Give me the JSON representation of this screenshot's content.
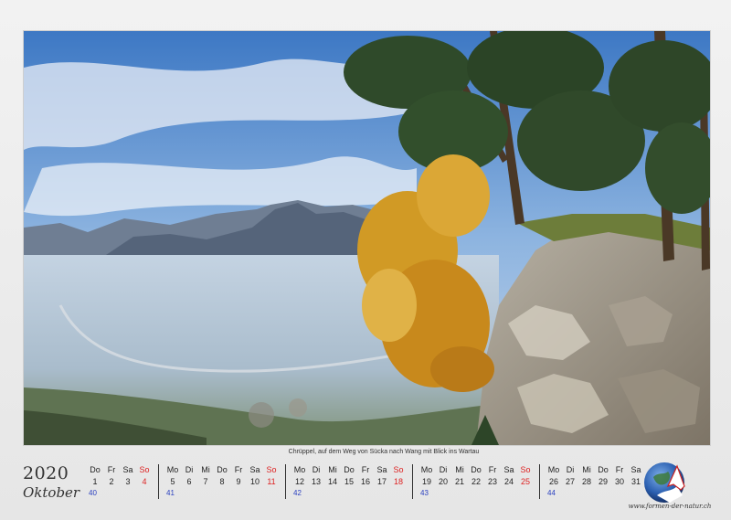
{
  "caption": "Chrüppel, auf dem Weg von Sücka nach Wang mit Blick ins Wartau",
  "year": "2020",
  "month": "Oktober",
  "accent_colors": {
    "sunday": "#dd2222",
    "week_number": "#2a3fbf"
  },
  "weeks": [
    {
      "kw": "40",
      "days": [
        {
          "dn": "Do",
          "d": "1"
        },
        {
          "dn": "Fr",
          "d": "2"
        },
        {
          "dn": "Sa",
          "d": "3"
        },
        {
          "dn": "So",
          "d": "4",
          "sun": true
        }
      ]
    },
    {
      "kw": "41",
      "days": [
        {
          "dn": "Mo",
          "d": "5"
        },
        {
          "dn": "Di",
          "d": "6"
        },
        {
          "dn": "Mi",
          "d": "7"
        },
        {
          "dn": "Do",
          "d": "8"
        },
        {
          "dn": "Fr",
          "d": "9"
        },
        {
          "dn": "Sa",
          "d": "10"
        },
        {
          "dn": "So",
          "d": "11",
          "sun": true
        }
      ]
    },
    {
      "kw": "42",
      "days": [
        {
          "dn": "Mo",
          "d": "12"
        },
        {
          "dn": "Di",
          "d": "13"
        },
        {
          "dn": "Mi",
          "d": "14"
        },
        {
          "dn": "Do",
          "d": "15"
        },
        {
          "dn": "Fr",
          "d": "16"
        },
        {
          "dn": "Sa",
          "d": "17"
        },
        {
          "dn": "So",
          "d": "18",
          "sun": true
        }
      ]
    },
    {
      "kw": "43",
      "days": [
        {
          "dn": "Mo",
          "d": "19"
        },
        {
          "dn": "Di",
          "d": "20"
        },
        {
          "dn": "Mi",
          "d": "21"
        },
        {
          "dn": "Do",
          "d": "22"
        },
        {
          "dn": "Fr",
          "d": "23"
        },
        {
          "dn": "Sa",
          "d": "24"
        },
        {
          "dn": "So",
          "d": "25",
          "sun": true
        }
      ]
    },
    {
      "kw": "44",
      "days": [
        {
          "dn": "Mo",
          "d": "26"
        },
        {
          "dn": "Di",
          "d": "27"
        },
        {
          "dn": "Mi",
          "d": "28"
        },
        {
          "dn": "Do",
          "d": "29"
        },
        {
          "dn": "Fr",
          "d": "30"
        },
        {
          "dn": "Sa",
          "d": "31"
        }
      ]
    }
  ],
  "logo_text": "www.formen-der-natur.ch",
  "photo_icon": "landscape-photo"
}
